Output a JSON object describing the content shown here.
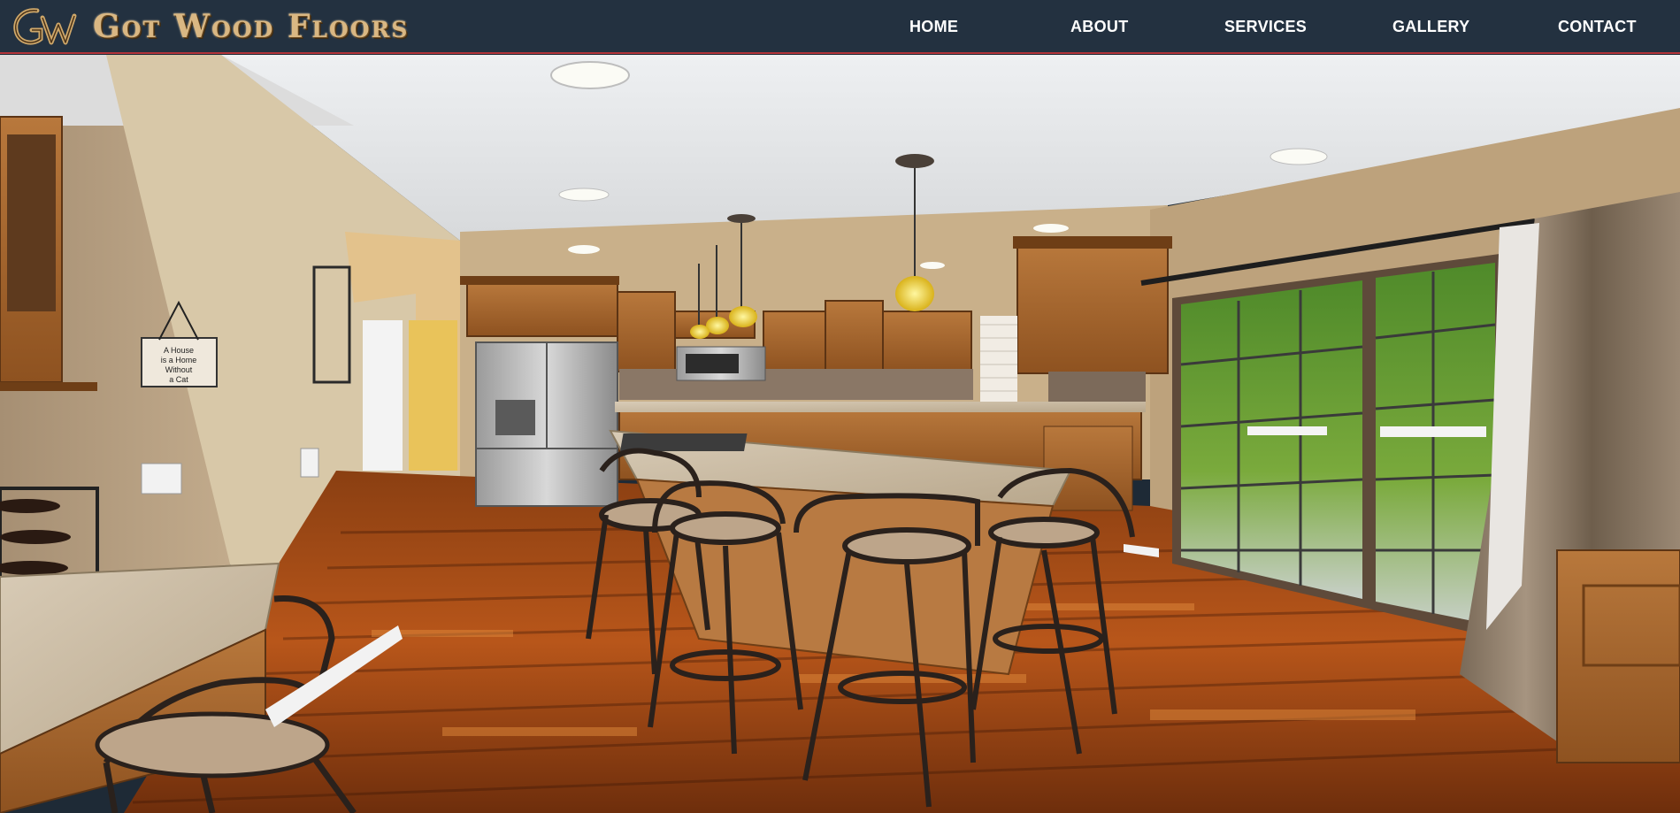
{
  "header": {
    "logo_monogram": "GW",
    "brand_name": "Got Wood Floors",
    "nav": [
      {
        "label": "HOME"
      },
      {
        "label": "ABOUT"
      },
      {
        "label": "SERVICES"
      },
      {
        "label": "GALLERY"
      },
      {
        "label": "CONTACT"
      }
    ],
    "colors": {
      "bar": "#233140",
      "accent_line": "#b3343a",
      "brand_text": "#d9b783",
      "nav_text": "#ffffff"
    }
  },
  "hero": {
    "wall_sign_text": "A House is a Home Without a Cat",
    "icons": [
      "recessed-light-icon",
      "pendant-lamp-icon",
      "bar-stool-icon",
      "refrigerator-icon",
      "sliding-door-icon",
      "wine-rack-icon"
    ]
  }
}
